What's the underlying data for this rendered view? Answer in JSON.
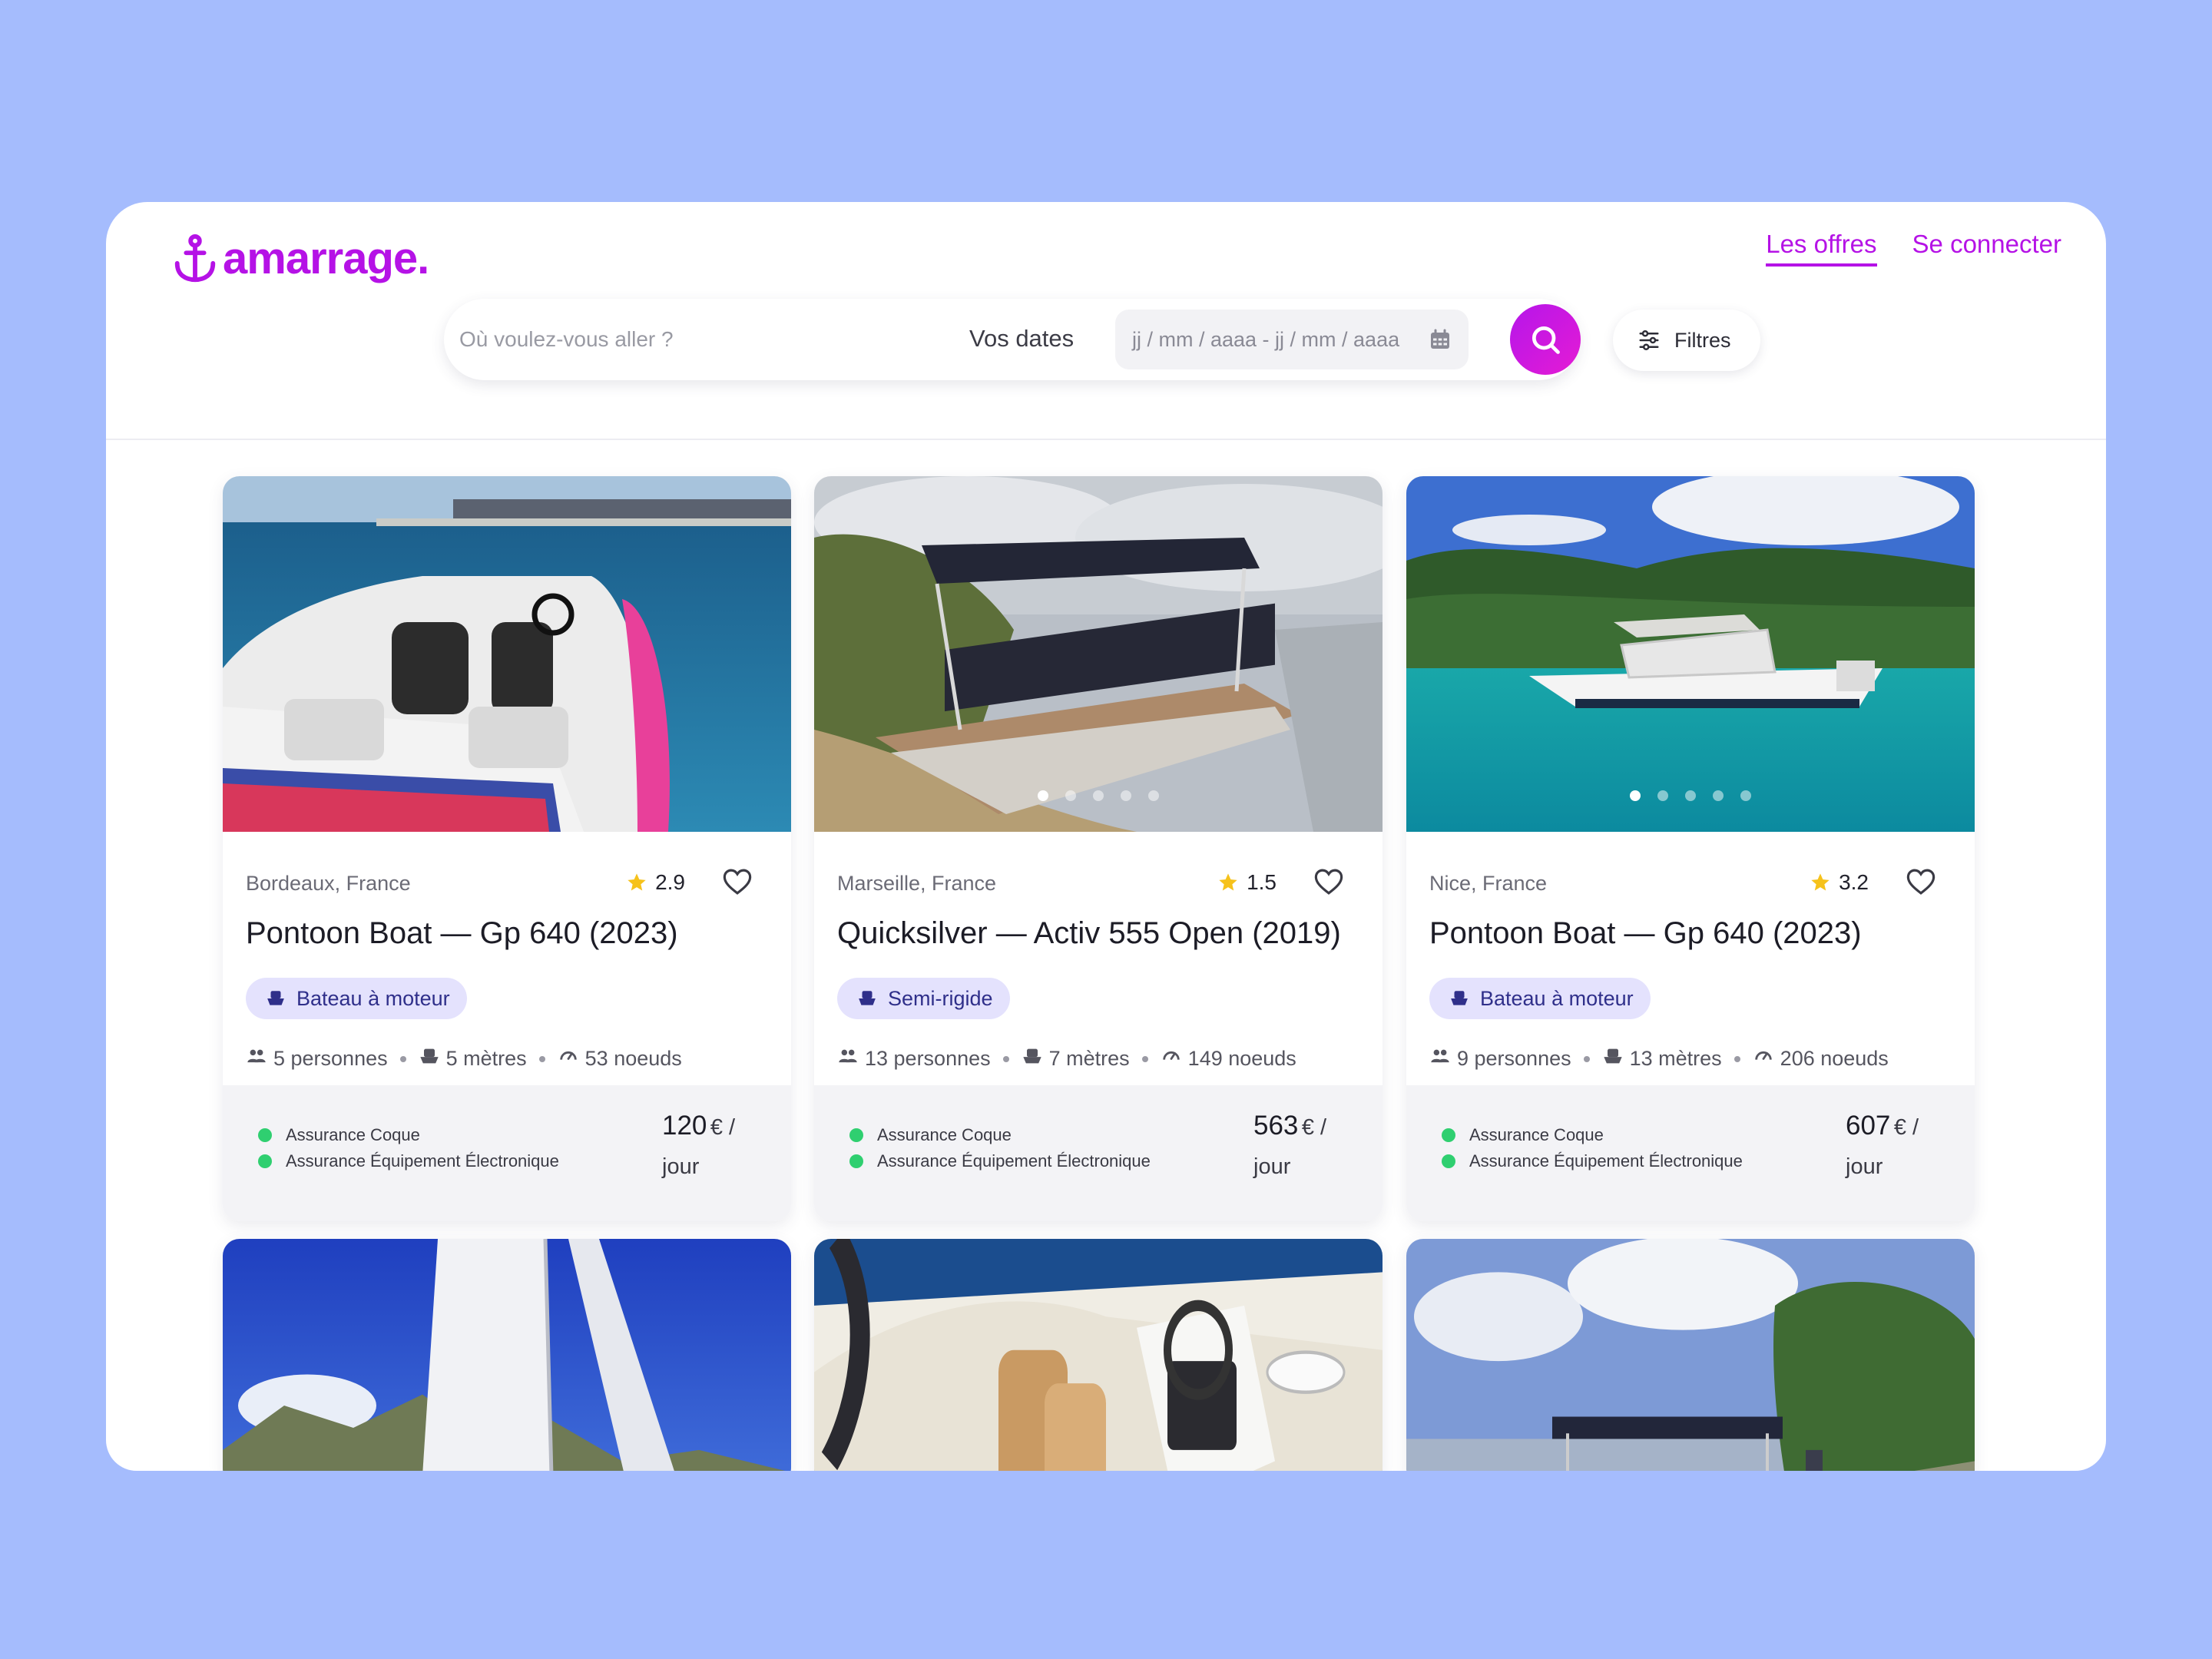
{
  "brand": {
    "name": "amarrage.",
    "color": "#b512e6"
  },
  "nav": {
    "offers": "Les offres",
    "login": "Se connecter"
  },
  "search": {
    "placeholder": "Où voulez-vous aller ?",
    "dates_label": "Vos dates",
    "dates_placeholder": "jj / mm / aaaa  -  jj / mm / aaaa",
    "filters_label": "Filtres"
  },
  "listings": [
    {
      "location": "Bordeaux, France",
      "rating": "2.9",
      "title": "Pontoon Boat — Gp 640 (2023)",
      "type": "Bateau à moteur",
      "people": "5 personnes",
      "length": "5 mètres",
      "speed": "53 noeuds",
      "insurance": [
        "Assurance Coque",
        "Assurance Équipement Électronique"
      ],
      "price": "120",
      "currency_unit": "€ /",
      "per": "jour",
      "photo": "speedboat-deck",
      "carousel_dots": 0,
      "active_dot": 0
    },
    {
      "location": "Marseille, France",
      "rating": "1.5",
      "title": "Quicksilver — Activ 555 Open (2019)",
      "type": "Semi-rigide",
      "people": "13 personnes",
      "length": "7 mètres",
      "speed": "149 noeuds",
      "insurance": [
        "Assurance Coque",
        "Assurance Équipement Électronique"
      ],
      "price": "563",
      "currency_unit": "€ /",
      "per": "jour",
      "photo": "pontoon-shore",
      "carousel_dots": 5,
      "active_dot": 0
    },
    {
      "location": "Nice, France",
      "rating": "3.2",
      "title": "Pontoon Boat — Gp 640 (2023)",
      "type": "Bateau à moteur",
      "people": "9 personnes",
      "length": "13 mètres",
      "speed": "206 noeuds",
      "insurance": [
        "Assurance Coque",
        "Assurance Équipement Électronique"
      ],
      "price": "607",
      "currency_unit": "€ /",
      "per": "jour",
      "photo": "motorboat-turquoise",
      "carousel_dots": 5,
      "active_dot": 0
    }
  ],
  "next_row_photos": [
    "sailboat-mountains",
    "boat-cockpit",
    "pontoon-lake"
  ]
}
